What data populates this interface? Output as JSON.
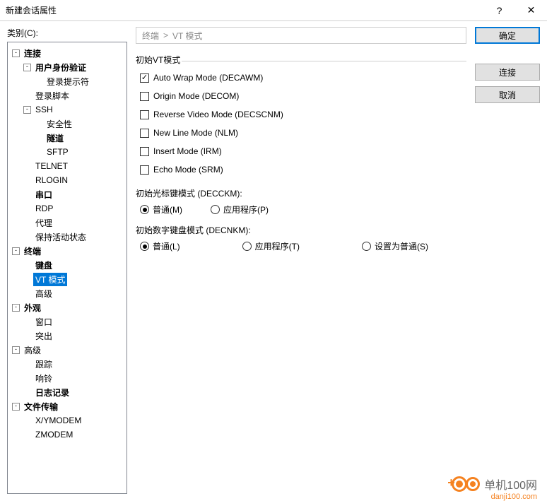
{
  "title": "新建会话属性",
  "category_label": "类别(C):",
  "tree": [
    {
      "depth": 1,
      "toggle": "-",
      "label": "连接",
      "bold": true
    },
    {
      "depth": 2,
      "toggle": "-",
      "label": "用户身份验证",
      "bold": true
    },
    {
      "depth": 3,
      "toggle": "",
      "label": "登录提示符"
    },
    {
      "depth": 2,
      "toggle": "",
      "label": "登录脚本"
    },
    {
      "depth": 2,
      "toggle": "-",
      "label": "SSH"
    },
    {
      "depth": 3,
      "toggle": "",
      "label": "安全性"
    },
    {
      "depth": 3,
      "toggle": "",
      "label": "隧道",
      "bold": true
    },
    {
      "depth": 3,
      "toggle": "",
      "label": "SFTP"
    },
    {
      "depth": 2,
      "toggle": "",
      "label": "TELNET"
    },
    {
      "depth": 2,
      "toggle": "",
      "label": "RLOGIN"
    },
    {
      "depth": 2,
      "toggle": "",
      "label": "串口",
      "bold": true
    },
    {
      "depth": 2,
      "toggle": "",
      "label": "RDP"
    },
    {
      "depth": 2,
      "toggle": "",
      "label": "代理"
    },
    {
      "depth": 2,
      "toggle": "",
      "label": "保持活动状态"
    },
    {
      "depth": 1,
      "toggle": "-",
      "label": "终端",
      "bold": true
    },
    {
      "depth": 2,
      "toggle": "",
      "label": "键盘",
      "bold": true
    },
    {
      "depth": 2,
      "toggle": "",
      "label": "VT 模式",
      "selected": true
    },
    {
      "depth": 2,
      "toggle": "",
      "label": "高级"
    },
    {
      "depth": 1,
      "toggle": "-",
      "label": "外观",
      "bold": true
    },
    {
      "depth": 2,
      "toggle": "",
      "label": "窗口"
    },
    {
      "depth": 2,
      "toggle": "",
      "label": "突出"
    },
    {
      "depth": 1,
      "toggle": "-",
      "label": "高级"
    },
    {
      "depth": 2,
      "toggle": "",
      "label": "跟踪"
    },
    {
      "depth": 2,
      "toggle": "",
      "label": "响铃"
    },
    {
      "depth": 2,
      "toggle": "",
      "label": "日志记录",
      "bold": true
    },
    {
      "depth": 1,
      "toggle": "-",
      "label": "文件传输",
      "bold": true
    },
    {
      "depth": 2,
      "toggle": "",
      "label": "X/YMODEM"
    },
    {
      "depth": 2,
      "toggle": "",
      "label": "ZMODEM"
    }
  ],
  "breadcrumb": {
    "part1": "终端",
    "sep": ">",
    "part2": "VT 模式"
  },
  "fieldset_title": "初始VT模式",
  "checks": [
    {
      "label": "Auto Wrap Mode (DECAWM)",
      "checked": true
    },
    {
      "label": "Origin Mode (DECOM)",
      "checked": false
    },
    {
      "label": "Reverse Video Mode (DECSCNM)",
      "checked": false
    },
    {
      "label": "New Line Mode (NLM)",
      "checked": false
    },
    {
      "label": "Insert Mode (IRM)",
      "checked": false
    },
    {
      "label": "Echo Mode (SRM)",
      "checked": false
    }
  ],
  "cursor_label": "初始光标键模式 (DECCKM):",
  "cursor_opts": [
    {
      "label": "普通(M)",
      "checked": true
    },
    {
      "label": "应用程序(P)",
      "checked": false
    }
  ],
  "keypad_label": "初始数字键盘模式 (DECNKM):",
  "keypad_opts": [
    {
      "label": "普通(L)",
      "checked": true
    },
    {
      "label": "应用程序(T)",
      "checked": false
    },
    {
      "label": "设置为普通(S)",
      "checked": false
    }
  ],
  "buttons": {
    "ok": "确定",
    "connect": "连接",
    "cancel": "取消"
  },
  "watermark": {
    "text": "单机100网",
    "url": "danji100.com"
  }
}
